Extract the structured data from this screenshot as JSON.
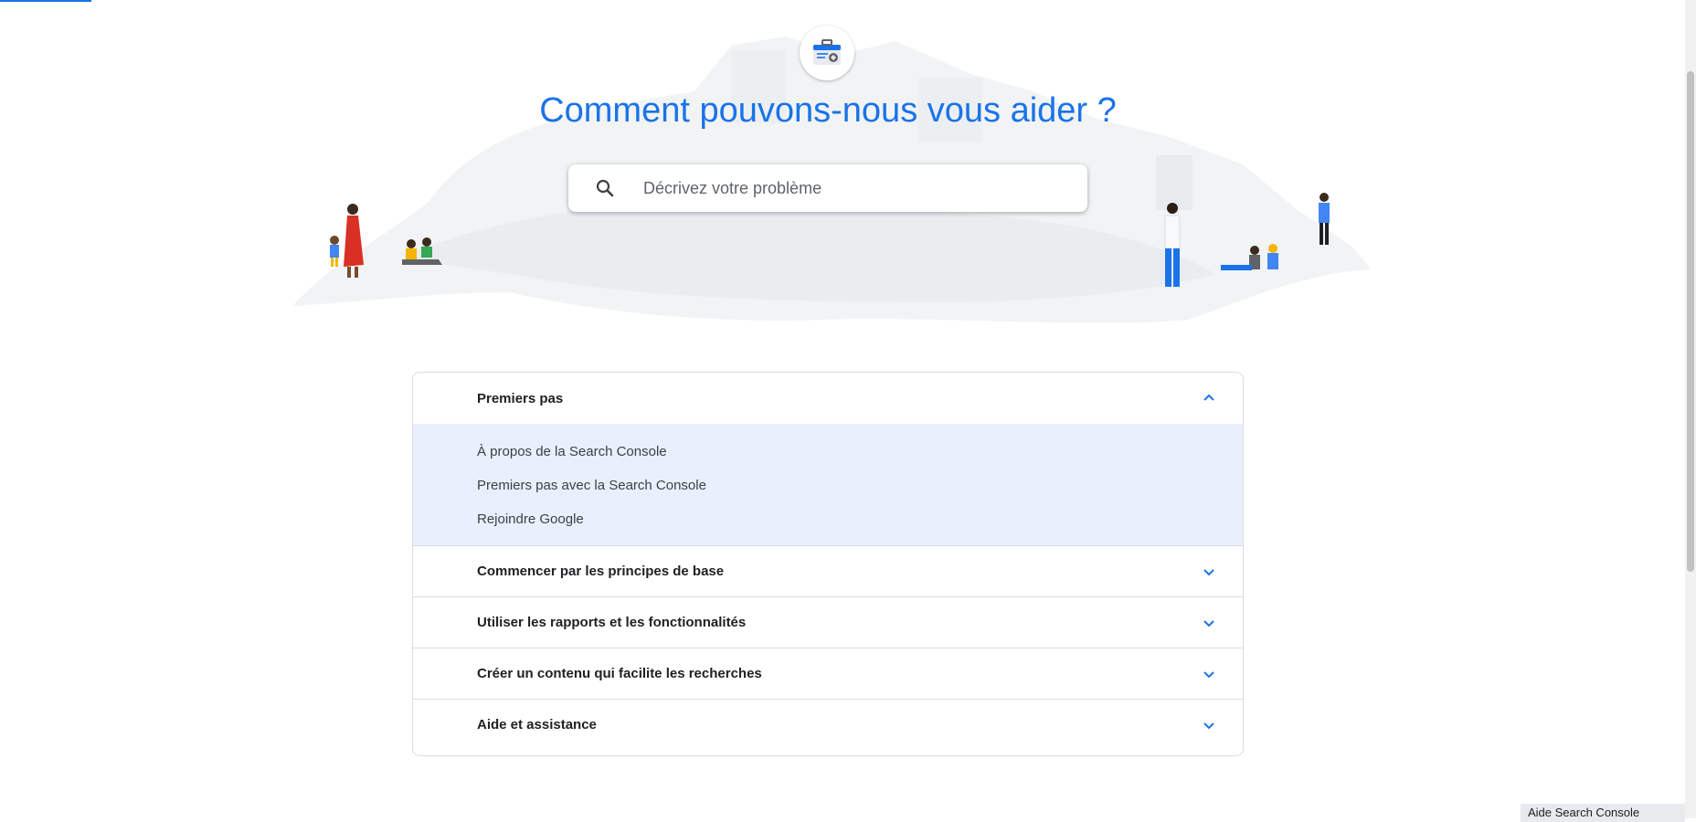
{
  "hero": {
    "title": "Comment pouvons-nous vous aider ?",
    "logo_icon": "search-console-toolbox-icon"
  },
  "search": {
    "placeholder": "Décrivez votre problème",
    "value": "",
    "icon": "search-icon"
  },
  "accordion": {
    "sections": [
      {
        "label": "Premiers pas",
        "expanded": true,
        "links": [
          "À propos de la Search Console",
          "Premiers pas avec la Search Console",
          "Rejoindre Google"
        ]
      },
      {
        "label": "Commencer par les principes de base",
        "expanded": false
      },
      {
        "label": "Utiliser les rapports et les fonctionnalités",
        "expanded": false
      },
      {
        "label": "Créer un contenu qui facilite les recherches",
        "expanded": false
      },
      {
        "label": "Aide et assistance",
        "expanded": false
      }
    ]
  },
  "footer": {
    "widget_label": "Aide Search Console"
  },
  "colors": {
    "accent": "#1a73e8",
    "expanded_bg": "#e8f0fe",
    "border": "#dadce0"
  }
}
